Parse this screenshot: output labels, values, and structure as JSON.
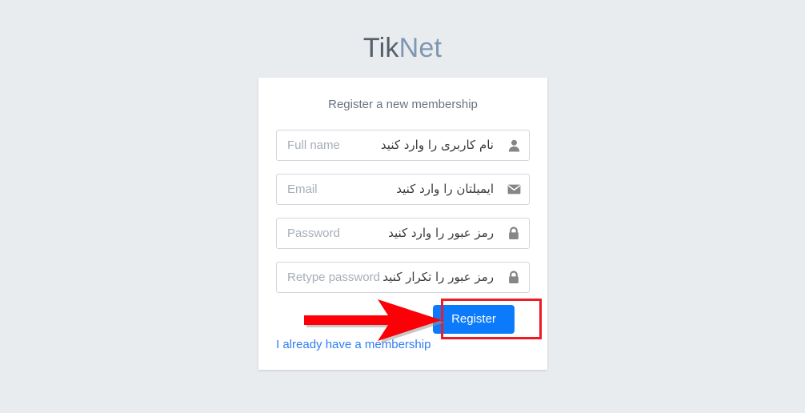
{
  "page": {
    "background_color": "#e9ecef"
  },
  "brand": {
    "part_strong": "Tik",
    "part_light": "Net",
    "color_strong": "#555f6b",
    "color_light": "#7f97b2"
  },
  "card": {
    "message": "Register a new membership",
    "background_color": "#ffffff"
  },
  "form": {
    "fields": [
      {
        "name": "full-name",
        "placeholder": "Full name",
        "value": "",
        "annotation_fa": "نام کاربری را وارد کنید",
        "icon": "user-icon"
      },
      {
        "name": "email",
        "placeholder": "Email",
        "value": "",
        "annotation_fa": "ایمیلتان را وارد کنید",
        "icon": "envelope-icon"
      },
      {
        "name": "password",
        "placeholder": "Password",
        "value": "",
        "annotation_fa": "رمز عبور را وارد کنید",
        "icon": "lock-icon"
      },
      {
        "name": "retype-password",
        "placeholder": "Retype password",
        "value": "",
        "annotation_fa": "رمز عبور را تکرار کنید",
        "icon": "lock-icon"
      }
    ]
  },
  "actions": {
    "register_label": "Register",
    "register_color": "#0b7afb",
    "login_link_label": "I already have a membership",
    "login_link_color": "#2f7ef0"
  },
  "annotations": {
    "highlight_color": "#ed1c24",
    "arrow_color": "#ed1c24",
    "arrow_target": "register-button"
  }
}
